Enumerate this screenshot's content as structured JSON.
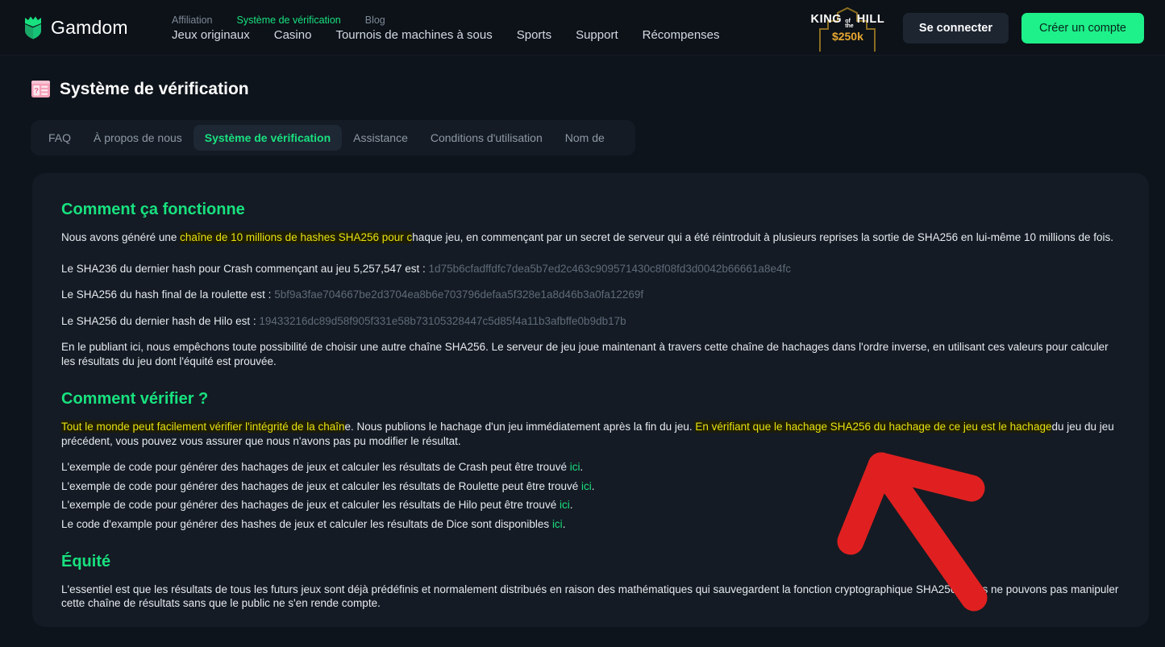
{
  "brand": {
    "name": "Gamdom",
    "logo_icon": "gamdom-crown-shield-icon",
    "color": "#1ef08a"
  },
  "header": {
    "top_nav": [
      {
        "label": "Affiliation",
        "active": false
      },
      {
        "label": "Système de vérification",
        "active": true
      },
      {
        "label": "Blog",
        "active": false
      }
    ],
    "main_nav": [
      {
        "label": "Jeux originaux"
      },
      {
        "label": "Casino"
      },
      {
        "label": "Tournois de machines à sous"
      },
      {
        "label": "Sports"
      },
      {
        "label": "Support"
      },
      {
        "label": "Récompenses"
      }
    ],
    "promo": {
      "king": "KING",
      "of": "of",
      "the": "the",
      "hill": "HILL",
      "amount": "$250k",
      "amount_color": "#e8a830"
    },
    "login_label": "Se connecter",
    "signup_label": "Créer un compte"
  },
  "page": {
    "title": "Système de vérification",
    "title_icon": "id-card-icon"
  },
  "tabs": [
    {
      "label": "FAQ",
      "active": false
    },
    {
      "label": "À propos de nous",
      "active": false
    },
    {
      "label": "Système de vérification",
      "active": true
    },
    {
      "label": "Assistance",
      "active": false
    },
    {
      "label": "Conditions d'utilisation",
      "active": false
    },
    {
      "label": "Nom de",
      "active": false
    }
  ],
  "content": {
    "section1_heading": "Comment ça fonctionne",
    "p1_a": "Nous avons généré une ",
    "p1_hl": "chaîne de 10 millions de hashes SHA256 pour c",
    "p1_b": "haque jeu, en commençant par un secret de serveur qui a été réintroduit à plusieurs reprises la sortie de SHA256 en lui-même 10 millions de fois.",
    "crash_label": "Le SHA236 du dernier hash pour Crash commençant au jeu 5,257,547 est : ",
    "crash_hash": "1d75b6cfadffdfc7dea5b7ed2c463c909571430c8f08fd3d0042b66661a8e4fc",
    "roulette_label": "Le SHA256 du hash final de la roulette est : ",
    "roulette_hash": "5bf9a3fae704667be2d3704ea8b6e703796defaa5f328e1a8d46b3a0fa12269f",
    "hilo_label": "Le SHA256 du dernier hash de Hilo est : ",
    "hilo_hash": "19433216dc89d58f905f331e58b73105328447c5d85f4a11b3afbffe0b9db17b",
    "p2": "En le publiant ici, nous empêchons toute possibilité de choisir une autre chaîne SHA256. Le serveur de jeu joue maintenant à travers cette chaîne de hachages dans l'ordre inverse, en utilisant ces valeurs pour calculer les résultats du jeu dont l'équité est prouvée.",
    "section2_heading": "Comment vérifier ?",
    "p3_hl1": "Tout le monde peut facilement vérifier l'intégrité de la chaîn",
    "p3_mid": "e. Nous publions le hachage d'un jeu immédiatement après la fin du jeu. ",
    "p3_hl2": "En vérifiant que le hachage SHA256 du hachage de ce jeu est le hachage",
    "p3_end": "du jeu du jeu précédent, vous pouvez vous assurer que nous n'avons pas pu modifier le résultat.",
    "code_lines": [
      {
        "text": "L'exemple de code pour générer des hachages de jeux et calculer les résultats de Crash peut être trouvé ",
        "link": "ici",
        "suffix": "."
      },
      {
        "text": "L'exemple de code pour générer des hachages de jeux et calculer les résultats de Roulette peut être trouvé ",
        "link": "ici",
        "suffix": "."
      },
      {
        "text": "L'exemple de code pour générer des hachages de jeux et calculer les résultats de Hilo peut être trouvé ",
        "link": "ici",
        "suffix": "."
      },
      {
        "text": "Le code d'example pour générer des hashes de jeux et calculer les résultats de Dice sont disponibles ",
        "link": "ici",
        "suffix": "."
      }
    ],
    "section3_heading": "Équité",
    "p4": "L'essentiel est que les résultats de tous les futurs jeux sont déjà prédéfinis et normalement distribués en raison des mathématiques qui sauvegardent la fonction cryptographique SHA256. Nous ne pouvons pas manipuler cette chaîne de résultats sans que le public ne s'en rende compte."
  },
  "annotation": {
    "shape": "red-arrow-pointing-up-left",
    "color": "#e02020"
  }
}
